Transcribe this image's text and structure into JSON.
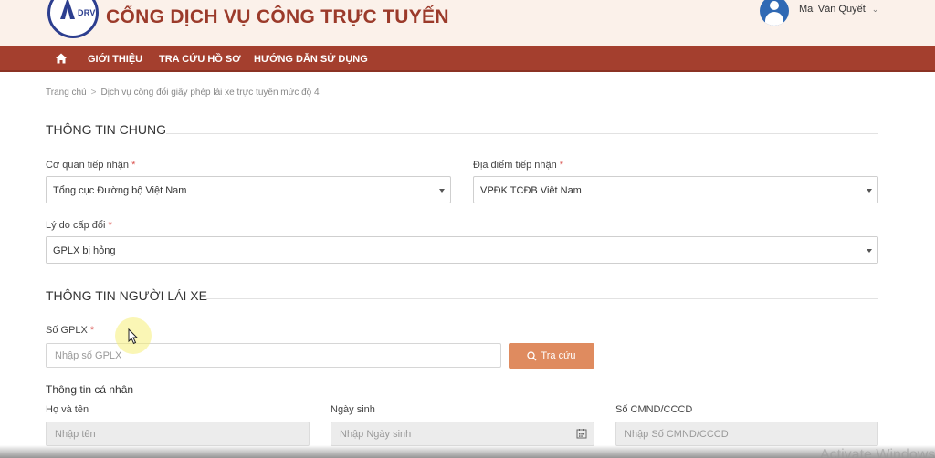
{
  "header": {
    "logo_text": "DRVN",
    "site_title": "CỔNG DỊCH VỤ CÔNG TRỰC TUYẾN",
    "user_name": "Mai Văn Quyết"
  },
  "nav": {
    "items": [
      "GIỚI THIỆU",
      "TRA CỨU HỒ SƠ",
      "HƯỚNG DẪN SỬ DỤNG"
    ]
  },
  "breadcrumb": {
    "home": "Trang chủ",
    "separator": ">",
    "current": "Dịch vụ công đổi giấy phép lái xe trực tuyến mức độ 4"
  },
  "general_info": {
    "title": "THÔNG TIN CHUNG",
    "agency": {
      "label": "Cơ quan tiếp nhận",
      "required": "*",
      "value": "Tổng cục Đường bộ Việt Nam"
    },
    "location": {
      "label": "Địa điểm tiếp nhận",
      "required": "*",
      "value": "VPĐK TCĐB Việt Nam"
    },
    "reason": {
      "label": "Lý do cấp đổi",
      "required": "*",
      "value": "GPLX bị hỏng"
    }
  },
  "driver_info": {
    "title": "THÔNG TIN NGƯỜI LÁI XE",
    "license": {
      "label": "Số GPLX",
      "required": "*",
      "placeholder": "Nhập số GPLX",
      "value": ""
    },
    "search_button": "Tra cứu",
    "personal_title": "Thông tin cá nhân",
    "full_name": {
      "label": "Họ và tên",
      "placeholder": "Nhập tên"
    },
    "dob": {
      "label": "Ngày sinh",
      "placeholder": "Nhập Ngày sinh"
    },
    "id_number": {
      "label": "Số CMND/CCCD",
      "placeholder": "Nhập Số CMND/CCCD"
    }
  },
  "watermark": "Activate Windows",
  "colors": {
    "nav_bar": "#a43f2e",
    "title": "#9b3a2a",
    "search_button": "#df8b5f",
    "logo": "#2c3e8f"
  }
}
